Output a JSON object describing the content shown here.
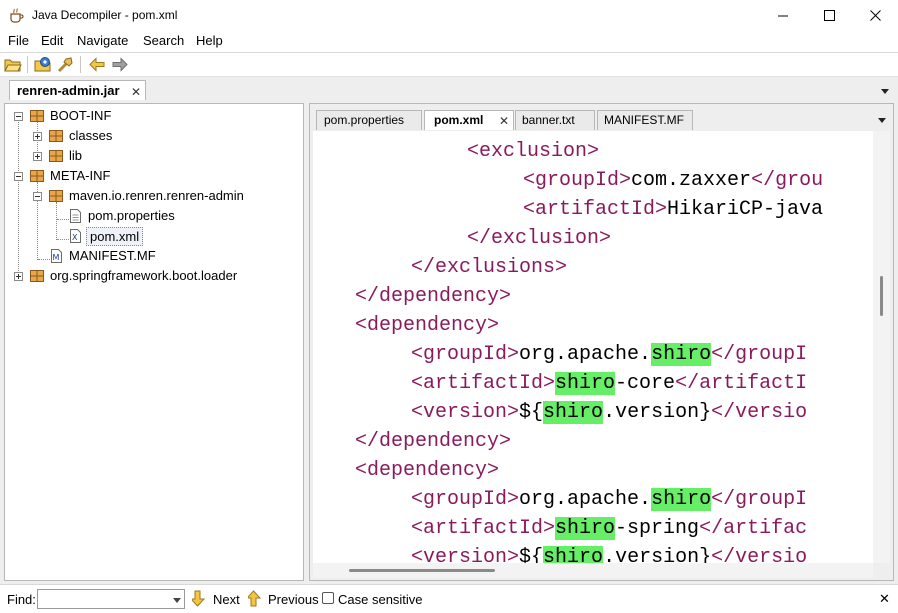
{
  "window": {
    "title": "Java Decompiler - pom.xml",
    "controls": [
      "minimize",
      "maximize",
      "close"
    ]
  },
  "menu": [
    "File",
    "Edit",
    "Navigate",
    "Search",
    "Help"
  ],
  "toolbar": {
    "icons": [
      "open-file-icon",
      "open-type-icon",
      "search-type-icon",
      "back-arrow-icon",
      "forward-arrow-icon"
    ]
  },
  "outer_tab": {
    "label": "renren-admin.jar",
    "close": "✕"
  },
  "tree": {
    "nodes": [
      {
        "label": "BOOT-INF",
        "expander": "minus",
        "icon": "package"
      },
      {
        "label": "classes",
        "expander": "plus",
        "icon": "package"
      },
      {
        "label": "lib",
        "expander": "plus",
        "icon": "package"
      },
      {
        "label": "META-INF",
        "expander": "minus",
        "icon": "package"
      },
      {
        "label": "maven.io.renren.renren-admin",
        "expander": "minus",
        "icon": "package"
      },
      {
        "label": "pom.properties",
        "expander": "",
        "icon": "file"
      },
      {
        "label": "pom.xml",
        "expander": "",
        "icon": "xml-file"
      },
      {
        "label": "MANIFEST.MF",
        "expander": "",
        "icon": "manifest-file"
      },
      {
        "label": "org.springframework.boot.loader",
        "expander": "plus",
        "icon": "package"
      }
    ]
  },
  "editor_tabs": [
    {
      "label": "pom.properties",
      "active": false
    },
    {
      "label": "pom.xml",
      "active": true,
      "close": "✕"
    },
    {
      "label": "banner.txt",
      "active": false
    },
    {
      "label": "MANIFEST.MF",
      "active": false
    }
  ],
  "code": {
    "lines": [
      [
        {
          "t": "<exclusion>",
          "c": "tag"
        }
      ],
      [
        {
          "t": "<groupId>",
          "c": "tag"
        },
        {
          "t": "com.zaxxer",
          "c": "txt"
        },
        {
          "t": "</grou",
          "c": "tag"
        }
      ],
      [
        {
          "t": "<artifactId>",
          "c": "tag"
        },
        {
          "t": "HikariCP-java",
          "c": "txt"
        }
      ],
      [
        {
          "t": "</exclusion>",
          "c": "tag"
        }
      ],
      [
        {
          "t": "</exclusions>",
          "c": "tag"
        }
      ],
      [
        {
          "t": "</dependency>",
          "c": "tag"
        }
      ],
      [
        {
          "t": "<dependency>",
          "c": "tag"
        }
      ],
      [
        {
          "t": "<groupId>",
          "c": "tag"
        },
        {
          "t": "org.apache.",
          "c": "txt"
        },
        {
          "t": "shiro",
          "c": "hl"
        },
        {
          "t": "</groupI",
          "c": "tag"
        }
      ],
      [
        {
          "t": "<artifactId>",
          "c": "tag"
        },
        {
          "t": "shiro",
          "c": "hl"
        },
        {
          "t": "-core",
          "c": "txt"
        },
        {
          "t": "</artifactI",
          "c": "tag"
        }
      ],
      [
        {
          "t": "<version>",
          "c": "tag"
        },
        {
          "t": "${",
          "c": "txt"
        },
        {
          "t": "shiro",
          "c": "hl"
        },
        {
          "t": ".version}",
          "c": "txt"
        },
        {
          "t": "</versio",
          "c": "tag"
        }
      ],
      [
        {
          "t": "</dependency>",
          "c": "tag"
        }
      ],
      [
        {
          "t": "<dependency>",
          "c": "tag"
        }
      ],
      [
        {
          "t": "<groupId>",
          "c": "tag"
        },
        {
          "t": "org.apache.",
          "c": "txt"
        },
        {
          "t": "shiro",
          "c": "hl"
        },
        {
          "t": "</groupI",
          "c": "tag"
        }
      ],
      [
        {
          "t": "<artifactId>",
          "c": "tag"
        },
        {
          "t": "shiro",
          "c": "hl"
        },
        {
          "t": "-spring",
          "c": "txt"
        },
        {
          "t": "</artifac",
          "c": "tag"
        }
      ],
      [
        {
          "t": "<version>",
          "c": "tag"
        },
        {
          "t": "${",
          "c": "txt"
        },
        {
          "t": "shiro",
          "c": "hl"
        },
        {
          "t": ".version}",
          "c": "txt"
        },
        {
          "t": "</versio",
          "c": "tag"
        }
      ]
    ]
  },
  "findbar": {
    "label": "Find:",
    "value": "",
    "next": "Next",
    "previous": "Previous",
    "case_sensitive": "Case sensitive",
    "close": "✕"
  },
  "colors": {
    "tag": "#8a1a5c",
    "highlight": "#66ee66"
  }
}
